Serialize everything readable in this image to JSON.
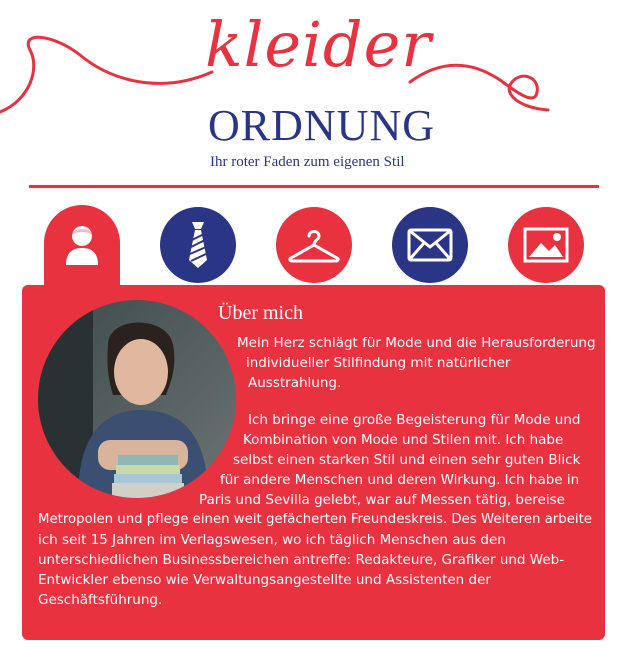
{
  "logo": {
    "script": "kleider",
    "title": "ORDNUNG",
    "tagline": "Ihr roter Faden zum eigenen Stil"
  },
  "nav": {
    "items": [
      {
        "icon": "person-icon",
        "active": true
      },
      {
        "icon": "tie-icon",
        "active": false
      },
      {
        "icon": "hanger-icon",
        "active": false
      },
      {
        "icon": "envelope-icon",
        "active": false
      },
      {
        "icon": "image-icon",
        "active": false
      }
    ]
  },
  "about": {
    "title": "Über mich",
    "lines": [
      "Mein Herz schlägt für Mode und die Herausforderung",
      "individueller Stilfindung mit natürlicher",
      "Ausstrahlung.",
      "Ich bringe eine große Begeisterung für Mode und",
      "Kombination von Mode und Stilen mit. Ich habe",
      "selbst einen starken Stil und einen sehr guten Blick",
      "für andere Menschen und deren Wirkung. Ich habe in",
      "Paris und Sevilla gelebt, war auf Messen tätig, bereise",
      "Metropolen und pflege einen weit gefächerten Freundeskreis. Des Weiteren arbeite",
      "ich seit 15 Jahren im Verlagswesen, wo ich täglich Menschen aus den",
      "unterschiedlichen Businessbereichen antreffe: Redakteure, Grafiker und Web-",
      "Entwickler ebenso wie Verwaltungsangestellte und Assistenten der",
      "Geschäftsführung."
    ]
  },
  "colors": {
    "accent_red": "#e8323f",
    "brand_blue": "#2b3585"
  }
}
